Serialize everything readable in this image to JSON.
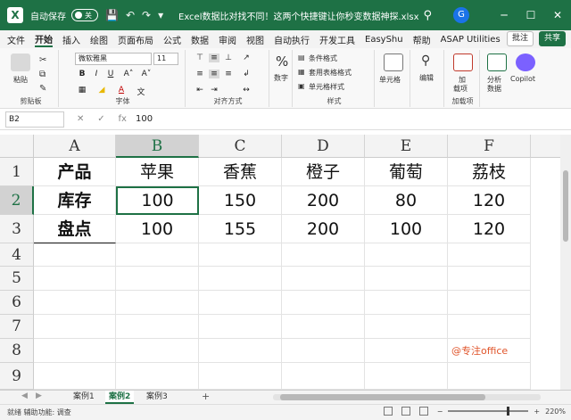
{
  "titlebar": {
    "autosave_label": "自动保存",
    "autosave_state": "关",
    "document_title": "Excel数据比对找不同！这两个快捷键让你秒变数据神探.xlsx",
    "avatar_letter": "G",
    "minimize": "─",
    "maximize": "☐",
    "close": "✕"
  },
  "menubar": {
    "items": [
      "文件",
      "开始",
      "插入",
      "绘图",
      "页面布局",
      "公式",
      "数据",
      "审阅",
      "视图",
      "自动执行",
      "开发工具",
      "EasyShu",
      "帮助",
      "ASAP Utilities"
    ],
    "active": "开始",
    "comment_button": "批注",
    "share_button": "共享"
  },
  "ribbon": {
    "clipboard": {
      "paste": "粘贴",
      "group": "剪贴板"
    },
    "font": {
      "name": "微软雅黑",
      "size": "11",
      "group": "字体"
    },
    "alignment": {
      "group": "对齐方式"
    },
    "number": {
      "label": "数字",
      "symbol": "%"
    },
    "styles": {
      "conditional": "条件格式",
      "table": "套用表格格式",
      "cell": "单元格样式",
      "group": "样式"
    },
    "cells": {
      "label": "单元格"
    },
    "editing": {
      "label": "编辑"
    },
    "addins": {
      "line1": "加",
      "line2": "载项",
      "group": "加载项"
    },
    "analysis": {
      "line1": "分析",
      "line2": "数据"
    },
    "copilot": "Copilot"
  },
  "formulabar": {
    "cell_ref": "B2",
    "value": "100",
    "fx": "fx"
  },
  "grid": {
    "column_headers": [
      "A",
      "B",
      "C",
      "D",
      "E",
      "F"
    ],
    "row_headers": [
      "1",
      "2",
      "3",
      "4",
      "5",
      "6",
      "7",
      "8",
      "9"
    ],
    "rows": [
      [
        "产品",
        "苹果",
        "香蕉",
        "橙子",
        "葡萄",
        "荔枝"
      ],
      [
        "库存",
        "100",
        "150",
        "200",
        "80",
        "120"
      ],
      [
        "盘点",
        "100",
        "155",
        "200",
        "100",
        "120"
      ]
    ],
    "selected_cell": "B2",
    "watermark": "@专注office"
  },
  "sheets": {
    "tabs": [
      "案例1",
      "案例2",
      "案例3"
    ],
    "active": "案例2",
    "add": "+"
  },
  "statusbar": {
    "left": "就绪  辅助功能: 调查",
    "zoom": "220%"
  }
}
